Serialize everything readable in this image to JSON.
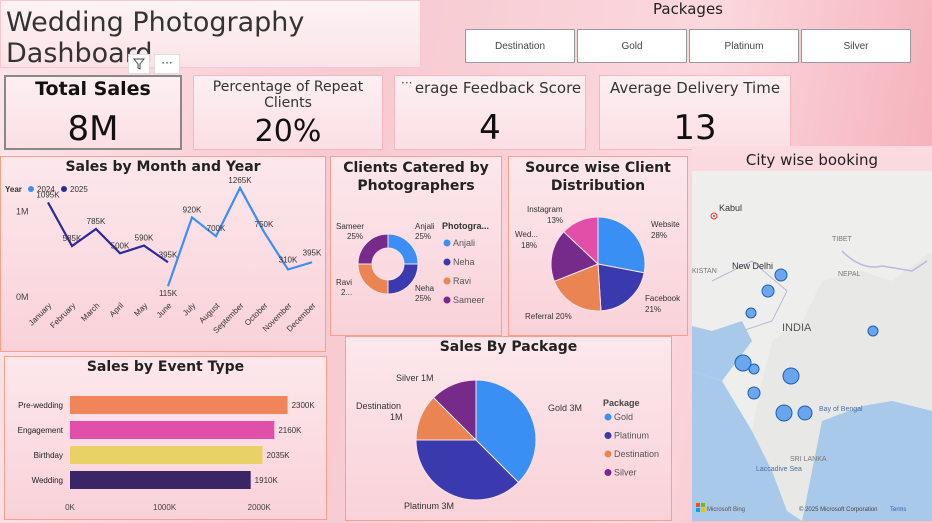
{
  "title": "Wedding Photography Dashboard",
  "packages_slicer": {
    "title": "Packages",
    "options": [
      "Destination",
      "Gold",
      "Platinum",
      "Silver"
    ]
  },
  "toolbar": {
    "filter_icon": "filter-icon",
    "more_icon": "more-options-icon"
  },
  "kpis": {
    "total_sales": {
      "label": "Total Sales",
      "value": "8M"
    },
    "repeat_clients": {
      "label": "Percentage of Repeat Clients",
      "value": "20%"
    },
    "feedback": {
      "label": "erage Feedback Score",
      "value": "4"
    },
    "delivery": {
      "label": "Average Delivery Time",
      "value": "13"
    }
  },
  "colors": {
    "navy": "#2b2a9c",
    "blue": "#3a8ff5",
    "indigo": "#3a3aae",
    "orange": "#ea8553",
    "purple": "#762b8b",
    "pink": "#e14fa8",
    "yellow": "#e8d265",
    "dark_purple": "#3a2566",
    "bar_orange": "#f0855a"
  },
  "chart_data": [
    {
      "id": "sales_by_month",
      "type": "line",
      "title": "Sales by Month and Year",
      "legend_title": "Year",
      "legend_position": "top-left",
      "categories": [
        "January",
        "February",
        "March",
        "April",
        "May",
        "June",
        "July",
        "August",
        "September",
        "October",
        "November",
        "December"
      ],
      "series": [
        {
          "name": "2024",
          "color": "#3a8ff5",
          "values": [
            null,
            null,
            null,
            null,
            null,
            115,
            920,
            700,
            1265,
            750,
            310,
            395
          ],
          "labels": [
            "",
            "",
            "",
            "",
            "",
            "115K",
            "920K",
            "700K",
            "1265K",
            "750K",
            "310K",
            "395K"
          ]
        },
        {
          "name": "2025",
          "color": "#2b2a9c",
          "values": [
            1095,
            585,
            785,
            500,
            590,
            395,
            null,
            null,
            null,
            null,
            null,
            null
          ],
          "labels": [
            "1095K",
            "585K",
            "785K",
            "500K",
            "590K",
            "395K",
            "",
            "",
            "",
            "",
            "",
            ""
          ]
        }
      ],
      "yticks": [
        "0M",
        "1M"
      ],
      "ylim": [
        0,
        1400
      ],
      "grid": false
    },
    {
      "id": "clients_by_photographer",
      "type": "pie",
      "donut": true,
      "title": "Clients Catered by Photographers",
      "legend_title": "Photogra...",
      "legend_position": "right",
      "slices": [
        {
          "name": "Anjali",
          "value": 25,
          "label": "25%",
          "color": "#3a8ff5"
        },
        {
          "name": "Neha",
          "value": 25,
          "label": "25%",
          "color": "#3a3aae"
        },
        {
          "name": "Ravi",
          "value": 25,
          "label": "2...",
          "color": "#ea8553"
        },
        {
          "name": "Sameer",
          "value": 25,
          "label": "25%",
          "color": "#762b8b"
        }
      ]
    },
    {
      "id": "source_distribution",
      "type": "pie",
      "title": "Source wise Client Distribution",
      "slices": [
        {
          "name": "Website",
          "value": 28,
          "label": "28%",
          "color": "#3a8ff5"
        },
        {
          "name": "Facebook",
          "value": 21,
          "label": "21%",
          "color": "#3a3aae"
        },
        {
          "name": "Referral",
          "value": 20,
          "label": "20%",
          "color": "#ea8553"
        },
        {
          "name": "Wed...",
          "value": 18,
          "label": "18%",
          "color": "#762b8b"
        },
        {
          "name": "Instagram",
          "value": 13,
          "label": "13%",
          "color": "#e14fa8"
        }
      ]
    },
    {
      "id": "sales_by_event",
      "type": "bar",
      "orientation": "horizontal",
      "title": "Sales by Event Type",
      "categories": [
        "Pre-wedding",
        "Engagement",
        "Birthday",
        "Wedding"
      ],
      "values": [
        2300,
        2160,
        2035,
        1910
      ],
      "labels": [
        "2300K",
        "2160K",
        "2035K",
        "1910K"
      ],
      "colors": [
        "#f0855a",
        "#e14fa8",
        "#e8d265",
        "#3a2566"
      ],
      "xticks": [
        "0K",
        "1000K",
        "2000K"
      ],
      "xlim": [
        0,
        2500
      ]
    },
    {
      "id": "sales_by_package",
      "type": "pie",
      "title": "Sales By Package",
      "legend_title": "Package",
      "legend_position": "right",
      "slices": [
        {
          "name": "Gold",
          "value": 3,
          "label": "Gold 3M",
          "color": "#3a8ff5"
        },
        {
          "name": "Platinum",
          "value": 3,
          "label": "Platinum 3M",
          "color": "#3a3aae"
        },
        {
          "name": "Destination",
          "value": 1,
          "label": "Destination 1M",
          "color": "#ea8553"
        },
        {
          "name": "Silver",
          "value": 1,
          "label": "Silver 1M",
          "color": "#762b8b"
        }
      ]
    }
  ],
  "map": {
    "title": "City wise booking",
    "labels": {
      "kabul": "Kabul",
      "tibet": "TIBET",
      "pakistan": "KISTAN",
      "newdelhi": "New Delhi",
      "nepal": "NEPAL",
      "india": "INDIA",
      "bay": "Bay of Bengal",
      "srilanka": "SRI LANKA",
      "sea": "Laccadive Sea"
    },
    "attribution": "© 2025 Microsoft Corporation",
    "terms": "Terms",
    "bing": "Microsoft Bing"
  }
}
